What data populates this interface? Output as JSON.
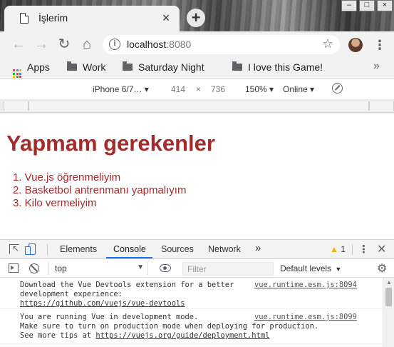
{
  "browser": {
    "tab_title": "İşlerim",
    "tab_close": "×",
    "new_tab": "+",
    "window_controls": {
      "minimize": "–",
      "maximize": "□",
      "close": "×"
    },
    "url_host": "localhost",
    "url_port": ":8080",
    "icons": {
      "back": "←",
      "forward": "→",
      "reload": "↻",
      "home": "⌂",
      "info": "i",
      "star": "☆",
      "menu": "⋮"
    }
  },
  "bookmarks": {
    "items": [
      {
        "label": "Apps"
      },
      {
        "label": "Work"
      },
      {
        "label": "Saturday Night"
      },
      {
        "label": "I love this Game!"
      }
    ],
    "more": "»"
  },
  "device_toolbar": {
    "model": "iPhone 6/7… ▾",
    "width": "414",
    "times": "×",
    "height": "736",
    "zoom": "150% ▾",
    "network": "Online ▾"
  },
  "page": {
    "heading": "Yapmam gerekenler",
    "todos": [
      "1. Vue.js öğrenmeliyim",
      "2. Basketbol antrenmanı yapmalıyım",
      "3. Kilo vermeliyim"
    ]
  },
  "devtools": {
    "tabs": {
      "elements": "Elements",
      "console": "Console",
      "sources": "Sources",
      "network": "Network",
      "more": "»"
    },
    "warning_count": "1",
    "warning_icon": "▲",
    "kebab": "⋮",
    "close": "✕",
    "context": "top",
    "context_arrow": "▼",
    "filter_placeholder": "Filter",
    "levels": "Default levels",
    "levels_arrow": "▼",
    "gear": "⚙",
    "messages": [
      {
        "lines": [
          "Download the Vue Devtools extension for a better",
          "development experience:"
        ],
        "link": "https://github.com/vuejs/vue-devtools",
        "source": "vue.runtime.esm.js:8094"
      },
      {
        "lines": [
          "You are running Vue in development mode.",
          "Make sure to turn on production mode when deploying for production.",
          "See more tips at "
        ],
        "link": "https://vuejs.org/guide/deployment.html",
        "source": "vue.runtime.esm.js:8099"
      }
    ],
    "scroll_up": "▲"
  },
  "colors": {
    "heading": "#a52a2a",
    "active_tab_indicator": "#1a73e8",
    "warning": "#f4b400"
  }
}
